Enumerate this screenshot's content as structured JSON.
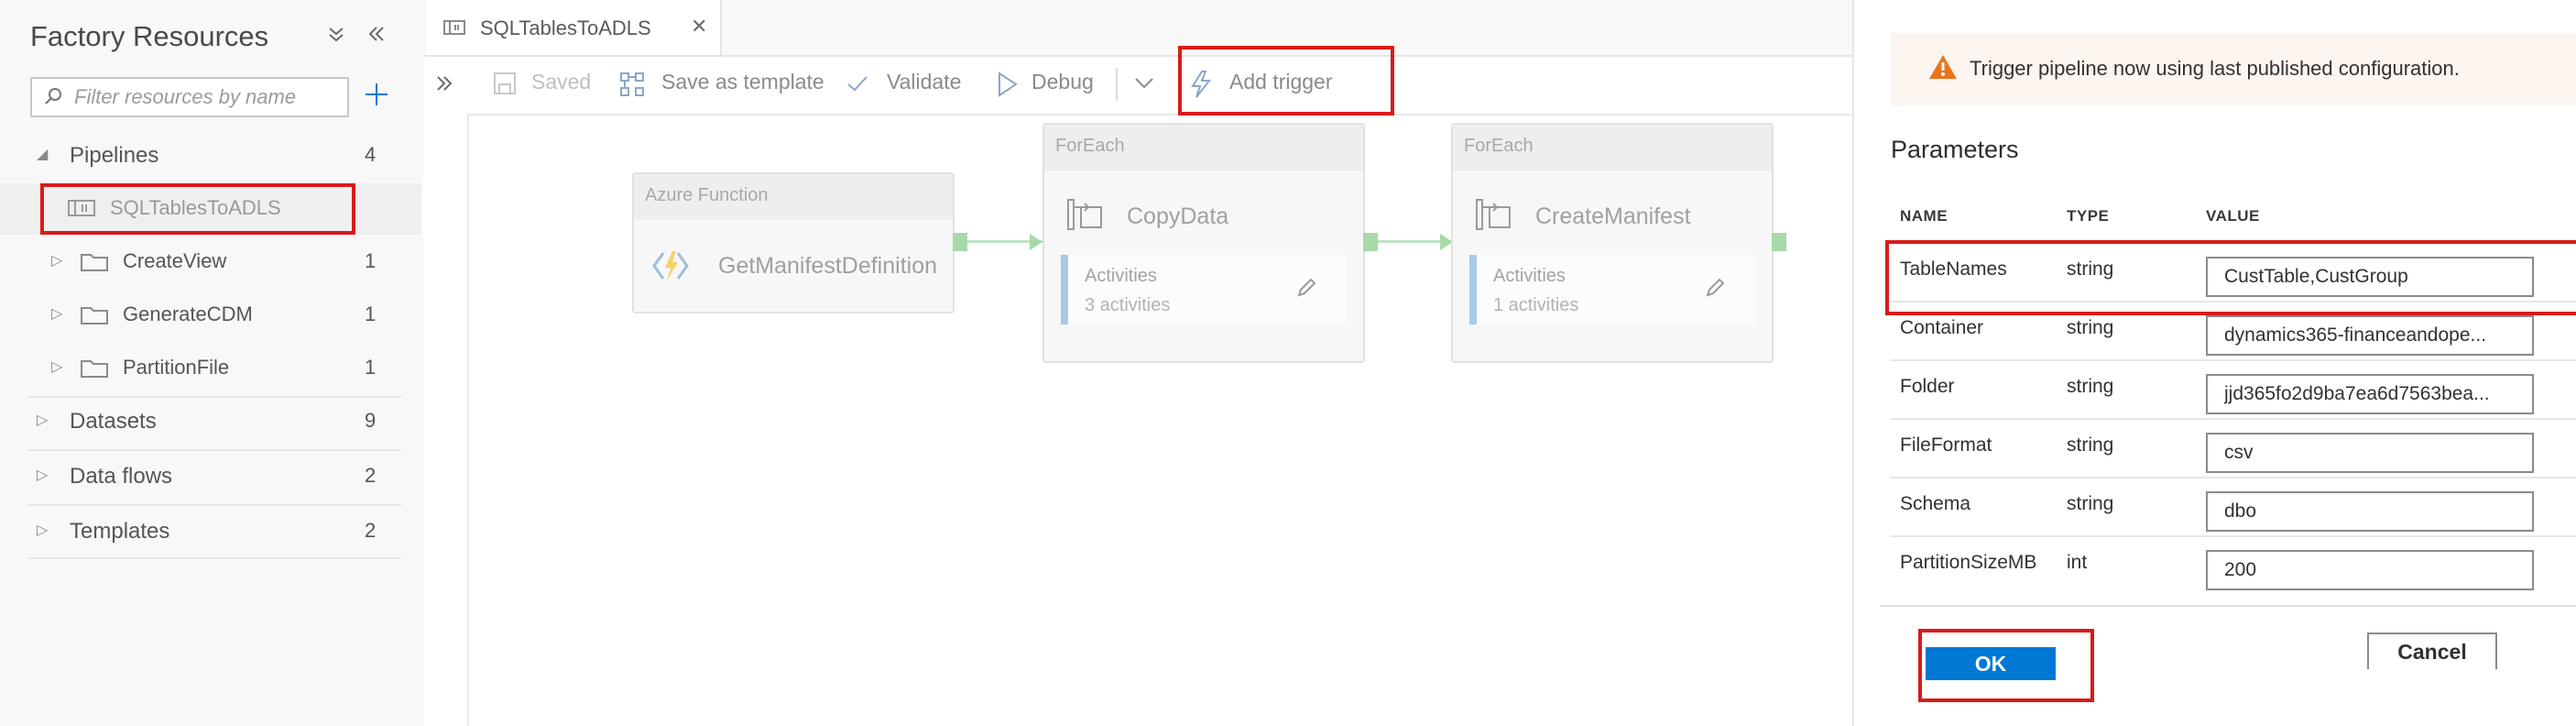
{
  "left_panel": {
    "title": "Factory Resources",
    "search_placeholder": "Filter resources by name",
    "sections": [
      {
        "label": "Pipelines",
        "count": "4"
      },
      {
        "label": "Datasets",
        "count": "9"
      },
      {
        "label": "Data flows",
        "count": "2"
      },
      {
        "label": "Templates",
        "count": "2"
      }
    ],
    "pipelines": [
      {
        "label": "SQLTablesToADLS",
        "count": ""
      },
      {
        "label": "CreateView",
        "count": "1"
      },
      {
        "label": "GenerateCDM",
        "count": "1"
      },
      {
        "label": "PartitionFile",
        "count": "1"
      }
    ]
  },
  "tab": {
    "label": "SQLTablesToADLS",
    "close": "✕"
  },
  "toolbar": {
    "saved": "Saved",
    "save_as_template": "Save as template",
    "validate": "Validate",
    "debug": "Debug",
    "add_trigger": "Add trigger"
  },
  "canvas": {
    "nodes": [
      {
        "type": "Azure Function",
        "name": "GetManifestDefinition"
      },
      {
        "type": "ForEach",
        "name": "CopyData",
        "activities_label": "Activities",
        "activities_count": "3 activities"
      },
      {
        "type": "ForEach",
        "name": "CreateManifest",
        "activities_label": "Activities",
        "activities_count": "1 activities"
      }
    ]
  },
  "trigger_panel": {
    "warning": "Trigger pipeline now using last published configuration.",
    "parameters_title": "Parameters",
    "columns": {
      "name": "NAME",
      "type": "TYPE",
      "value": "VALUE"
    },
    "params": [
      {
        "name": "TableNames",
        "type": "string",
        "value": "CustTable,CustGroup"
      },
      {
        "name": "Container",
        "type": "string",
        "value": "dynamics365-financeandope..."
      },
      {
        "name": "Folder",
        "type": "string",
        "value": "jjd365fo2d9ba7ea6d7563bea..."
      },
      {
        "name": "FileFormat",
        "type": "string",
        "value": "csv"
      },
      {
        "name": "Schema",
        "type": "string",
        "value": "dbo"
      },
      {
        "name": "PartitionSizeMB",
        "type": "int",
        "value": "200"
      }
    ],
    "ok_label": "OK",
    "cancel_label": "Cancel"
  },
  "colors": {
    "accent": "#0078d4",
    "highlight": "#d91a1a",
    "warning": "#e9751b"
  }
}
